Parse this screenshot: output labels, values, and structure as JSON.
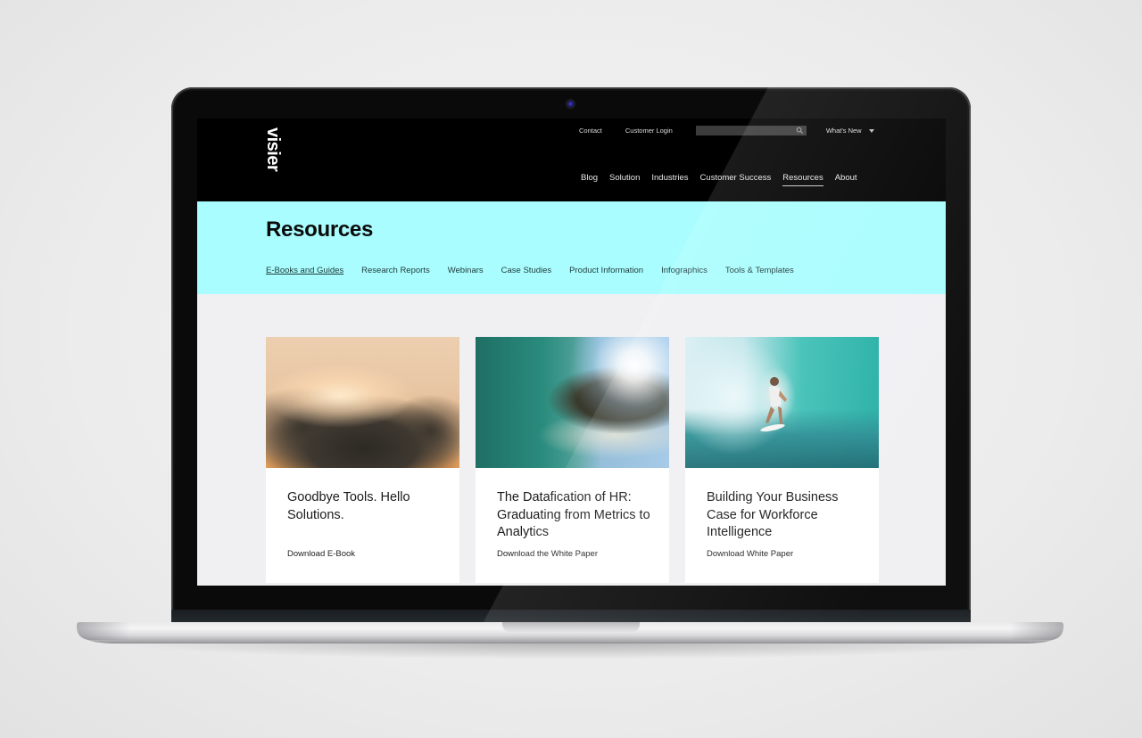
{
  "brand": {
    "logo_text": "visier"
  },
  "utility_nav": {
    "links": [
      "Contact",
      "Customer Login"
    ],
    "search": {
      "value": "",
      "placeholder": ""
    },
    "whats_new_label": "What's New"
  },
  "main_nav": {
    "items": [
      "Blog",
      "Solution",
      "Industries",
      "Customer Success",
      "Resources",
      "About"
    ],
    "active": "Resources"
  },
  "hero": {
    "title": "Resources",
    "sub_nav": [
      "E-Books and Guides",
      "Research Reports",
      "Webinars",
      "Case Studies",
      "Product Information",
      "Infographics",
      "Tools & Templates"
    ],
    "active": "E-Books and Guides"
  },
  "cards": [
    {
      "image": "sunlit-clouds",
      "title": "Goodbye Tools. Hello Solutions.",
      "cta": "Download E-Book"
    },
    {
      "image": "ocean-wave-barrel",
      "title": "The Datafication of HR: Graduating from Metrics to Analytics",
      "cta": "Download the White Paper"
    },
    {
      "image": "surfer-in-wave",
      "title": "Building Your Business Case for Workforce Intelligence",
      "cta": "Download White Paper"
    }
  ],
  "colors": {
    "header_bg": "#000000",
    "hero_bg": "#a9fdfe",
    "content_bg": "#f0f0f3"
  }
}
